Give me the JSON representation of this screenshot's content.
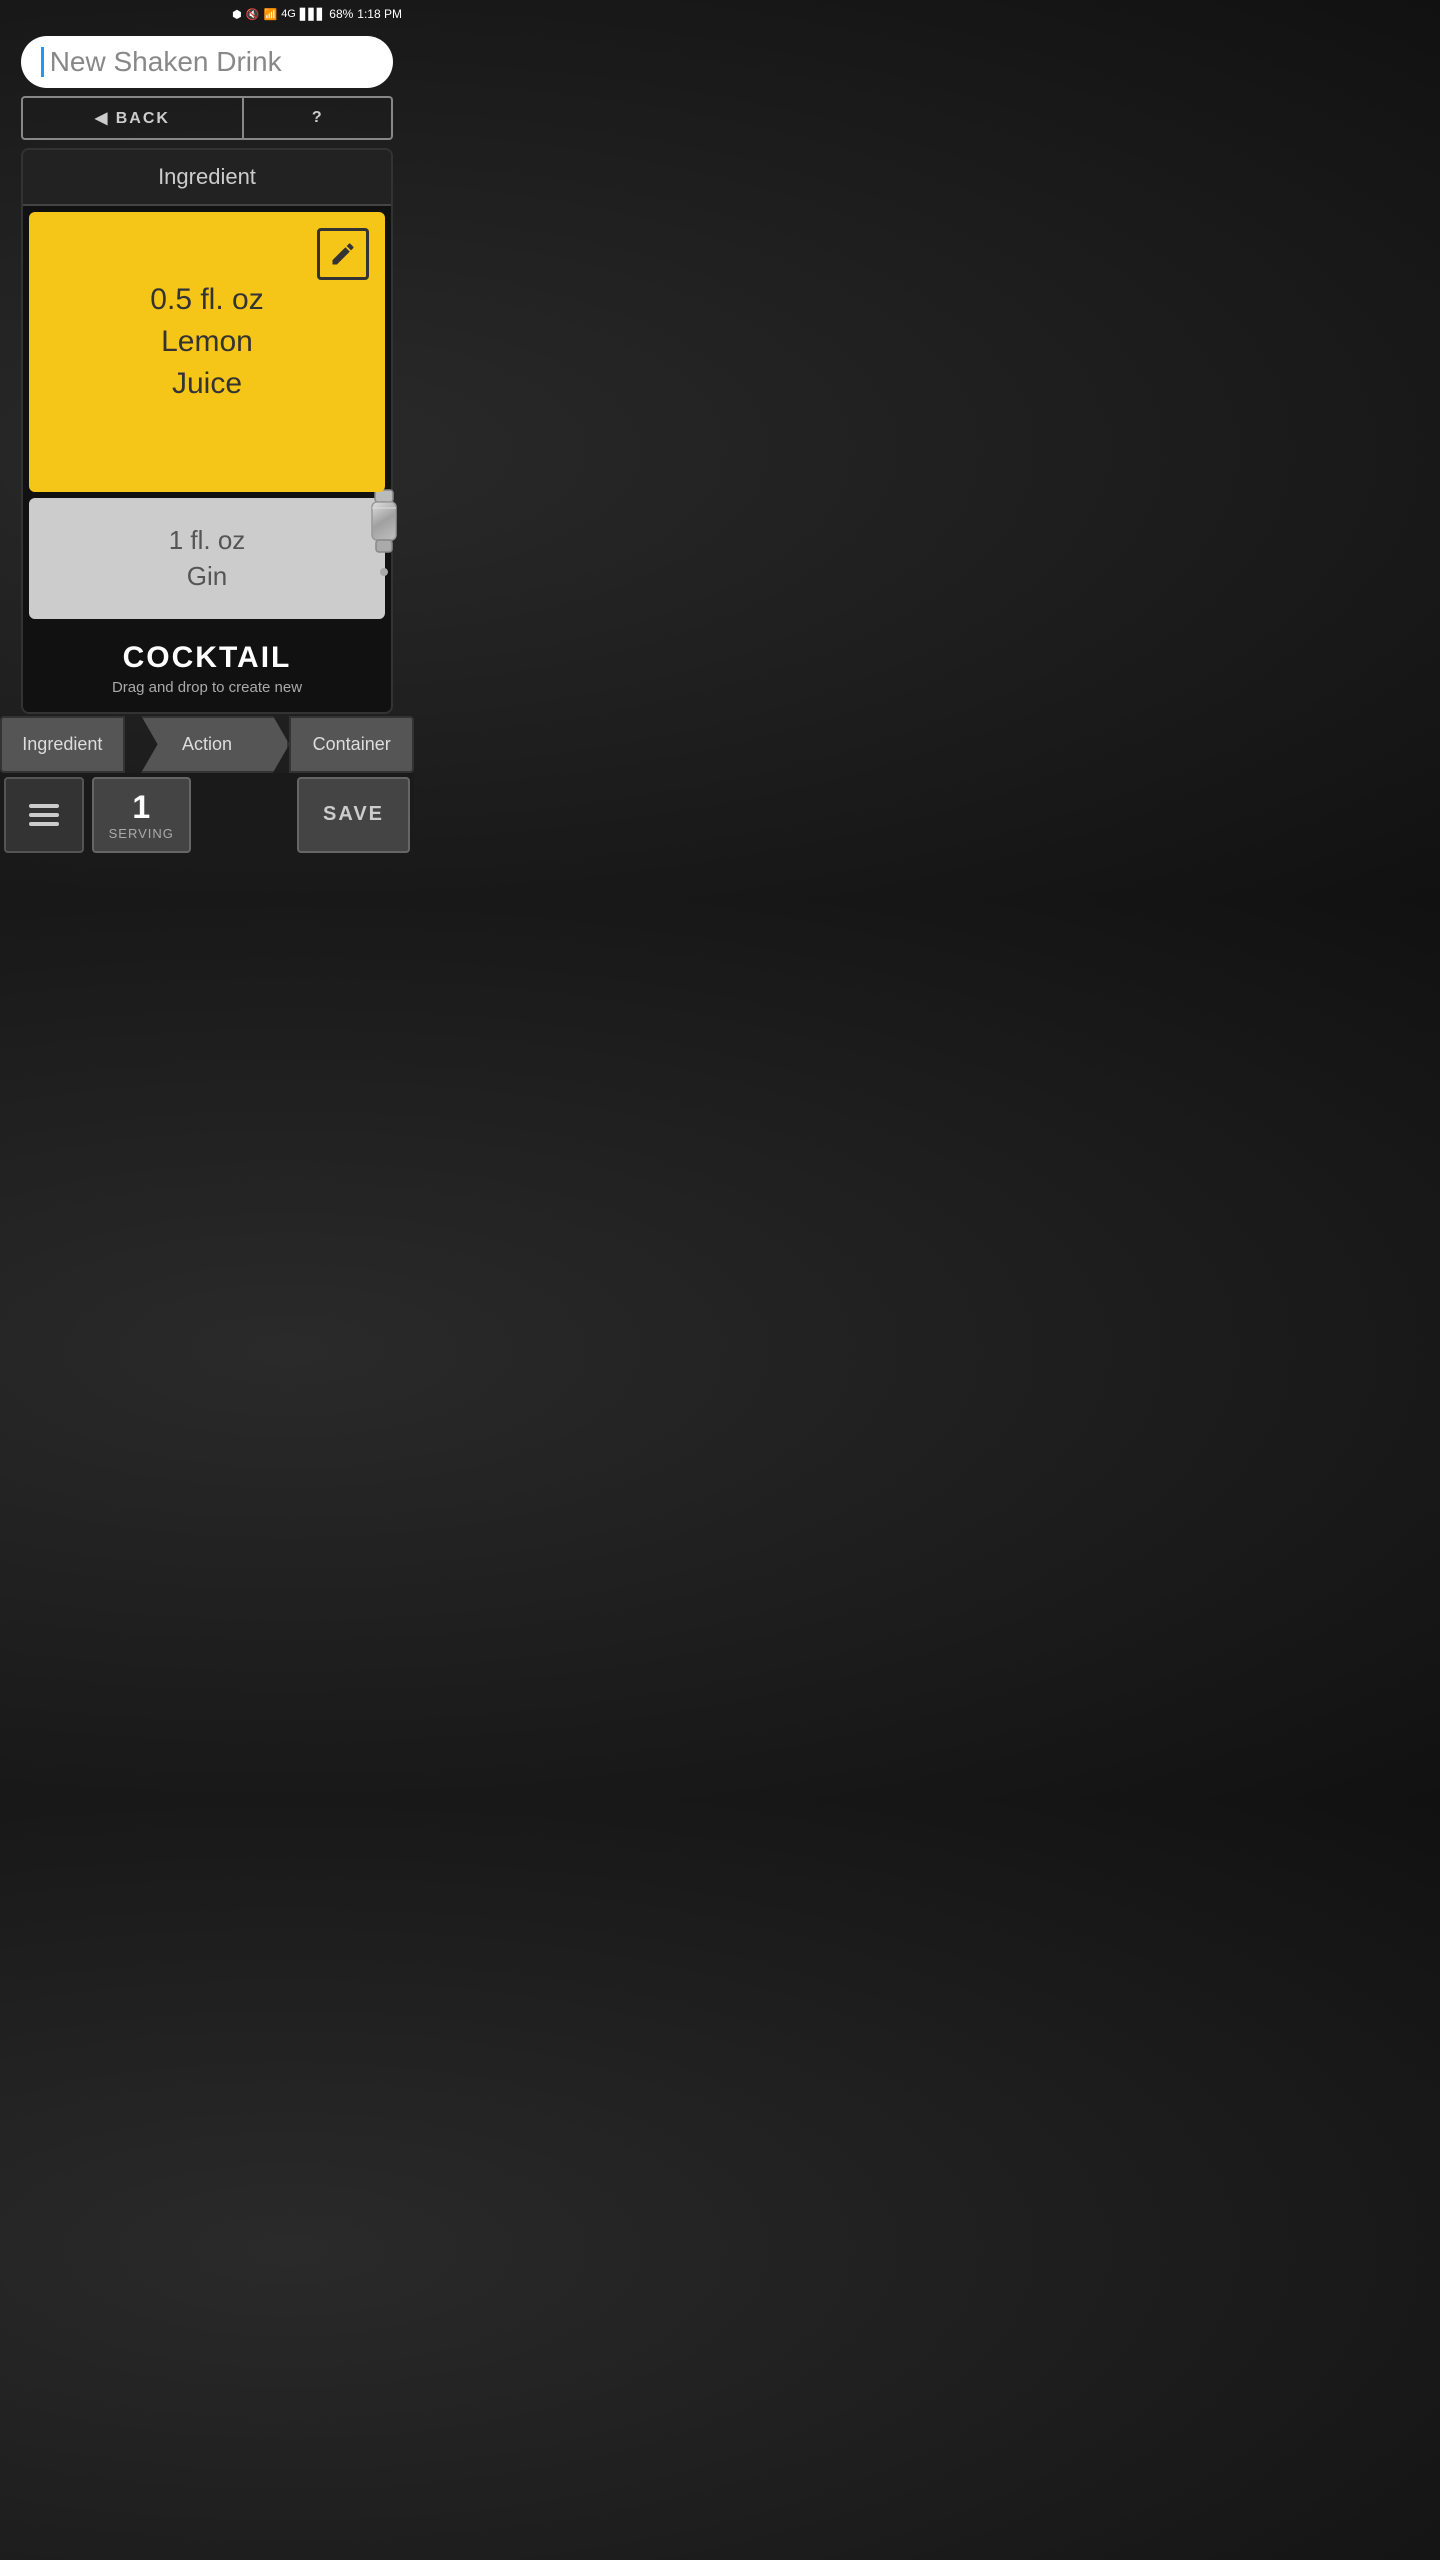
{
  "statusBar": {
    "bluetooth": "🔵",
    "mute": "🔇",
    "wifi": "📶",
    "network": "4G",
    "signal": "📶",
    "battery": "68%",
    "time": "1:18 PM"
  },
  "titleBar": {
    "placeholder": "New Shaken Drink"
  },
  "nav": {
    "backLabel": "◀ BACK",
    "helpLabel": "?"
  },
  "ingredientHeader": {
    "label": "Ingredient"
  },
  "activeCard": {
    "amount": "0.5 fl. oz",
    "name": "Lemon\nJuice"
  },
  "secondCard": {
    "amount": "1 fl. oz",
    "name": "Gin"
  },
  "cocktailSection": {
    "title": "COCKTAIL",
    "subtitle": "Drag and drop to create new"
  },
  "tabs": [
    {
      "label": "Ingredient",
      "active": false
    },
    {
      "label": "Action",
      "active": true
    },
    {
      "label": "Container",
      "active": false
    }
  ],
  "footer": {
    "servingNumber": "1",
    "servingLabel": "SERVING",
    "saveLabel": "SAVE"
  }
}
